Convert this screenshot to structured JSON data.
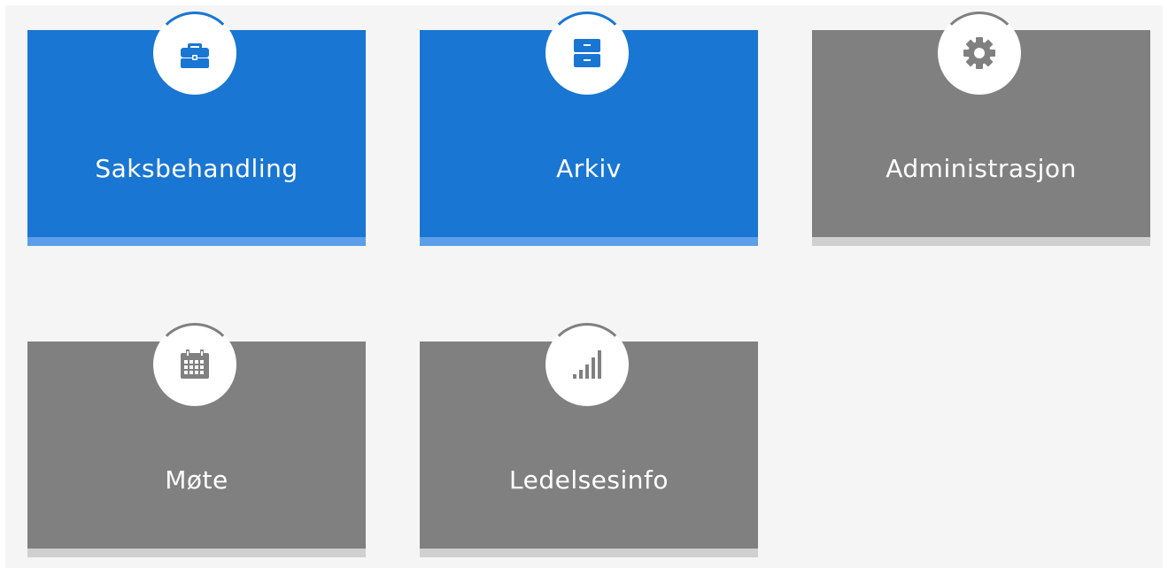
{
  "tiles": [
    {
      "label": "Saksbehandling",
      "icon": "briefcase-icon",
      "color": "#1976d2",
      "bar_color": "#5c9fe8"
    },
    {
      "label": "Arkiv",
      "icon": "archive-drawer-icon",
      "color": "#1976d2",
      "bar_color": "#5c9fe8"
    },
    {
      "label": "Administrasjon",
      "icon": "gear-icon",
      "color": "#808080",
      "bar_color": "#d0d0d0"
    },
    {
      "label": "Møte",
      "icon": "calendar-icon",
      "color": "#808080",
      "bar_color": "#d0d0d0"
    },
    {
      "label": "Ledelsesinfo",
      "icon": "bar-chart-icon",
      "color": "#808080",
      "bar_color": "#d0d0d0"
    }
  ],
  "background": "#f5f5f5"
}
